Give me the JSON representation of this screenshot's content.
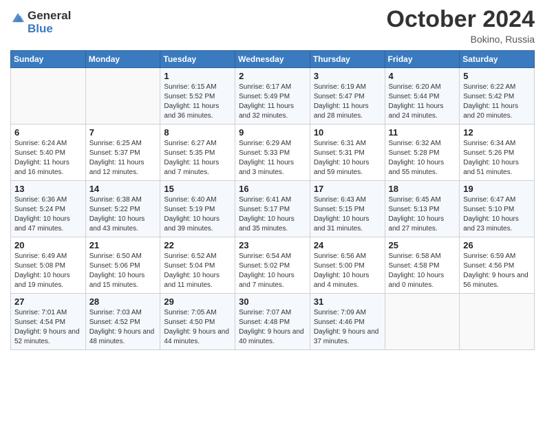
{
  "logo": {
    "general": "General",
    "blue": "Blue"
  },
  "title": "October 2024",
  "location": "Bokino, Russia",
  "days_of_week": [
    "Sunday",
    "Monday",
    "Tuesday",
    "Wednesday",
    "Thursday",
    "Friday",
    "Saturday"
  ],
  "weeks": [
    [
      {
        "day": "",
        "sunrise": "",
        "sunset": "",
        "daylight": ""
      },
      {
        "day": "",
        "sunrise": "",
        "sunset": "",
        "daylight": ""
      },
      {
        "day": "1",
        "sunrise": "Sunrise: 6:15 AM",
        "sunset": "Sunset: 5:52 PM",
        "daylight": "Daylight: 11 hours and 36 minutes."
      },
      {
        "day": "2",
        "sunrise": "Sunrise: 6:17 AM",
        "sunset": "Sunset: 5:49 PM",
        "daylight": "Daylight: 11 hours and 32 minutes."
      },
      {
        "day": "3",
        "sunrise": "Sunrise: 6:19 AM",
        "sunset": "Sunset: 5:47 PM",
        "daylight": "Daylight: 11 hours and 28 minutes."
      },
      {
        "day": "4",
        "sunrise": "Sunrise: 6:20 AM",
        "sunset": "Sunset: 5:44 PM",
        "daylight": "Daylight: 11 hours and 24 minutes."
      },
      {
        "day": "5",
        "sunrise": "Sunrise: 6:22 AM",
        "sunset": "Sunset: 5:42 PM",
        "daylight": "Daylight: 11 hours and 20 minutes."
      }
    ],
    [
      {
        "day": "6",
        "sunrise": "Sunrise: 6:24 AM",
        "sunset": "Sunset: 5:40 PM",
        "daylight": "Daylight: 11 hours and 16 minutes."
      },
      {
        "day": "7",
        "sunrise": "Sunrise: 6:25 AM",
        "sunset": "Sunset: 5:37 PM",
        "daylight": "Daylight: 11 hours and 12 minutes."
      },
      {
        "day": "8",
        "sunrise": "Sunrise: 6:27 AM",
        "sunset": "Sunset: 5:35 PM",
        "daylight": "Daylight: 11 hours and 7 minutes."
      },
      {
        "day": "9",
        "sunrise": "Sunrise: 6:29 AM",
        "sunset": "Sunset: 5:33 PM",
        "daylight": "Daylight: 11 hours and 3 minutes."
      },
      {
        "day": "10",
        "sunrise": "Sunrise: 6:31 AM",
        "sunset": "Sunset: 5:31 PM",
        "daylight": "Daylight: 10 hours and 59 minutes."
      },
      {
        "day": "11",
        "sunrise": "Sunrise: 6:32 AM",
        "sunset": "Sunset: 5:28 PM",
        "daylight": "Daylight: 10 hours and 55 minutes."
      },
      {
        "day": "12",
        "sunrise": "Sunrise: 6:34 AM",
        "sunset": "Sunset: 5:26 PM",
        "daylight": "Daylight: 10 hours and 51 minutes."
      }
    ],
    [
      {
        "day": "13",
        "sunrise": "Sunrise: 6:36 AM",
        "sunset": "Sunset: 5:24 PM",
        "daylight": "Daylight: 10 hours and 47 minutes."
      },
      {
        "day": "14",
        "sunrise": "Sunrise: 6:38 AM",
        "sunset": "Sunset: 5:22 PM",
        "daylight": "Daylight: 10 hours and 43 minutes."
      },
      {
        "day": "15",
        "sunrise": "Sunrise: 6:40 AM",
        "sunset": "Sunset: 5:19 PM",
        "daylight": "Daylight: 10 hours and 39 minutes."
      },
      {
        "day": "16",
        "sunrise": "Sunrise: 6:41 AM",
        "sunset": "Sunset: 5:17 PM",
        "daylight": "Daylight: 10 hours and 35 minutes."
      },
      {
        "day": "17",
        "sunrise": "Sunrise: 6:43 AM",
        "sunset": "Sunset: 5:15 PM",
        "daylight": "Daylight: 10 hours and 31 minutes."
      },
      {
        "day": "18",
        "sunrise": "Sunrise: 6:45 AM",
        "sunset": "Sunset: 5:13 PM",
        "daylight": "Daylight: 10 hours and 27 minutes."
      },
      {
        "day": "19",
        "sunrise": "Sunrise: 6:47 AM",
        "sunset": "Sunset: 5:10 PM",
        "daylight": "Daylight: 10 hours and 23 minutes."
      }
    ],
    [
      {
        "day": "20",
        "sunrise": "Sunrise: 6:49 AM",
        "sunset": "Sunset: 5:08 PM",
        "daylight": "Daylight: 10 hours and 19 minutes."
      },
      {
        "day": "21",
        "sunrise": "Sunrise: 6:50 AM",
        "sunset": "Sunset: 5:06 PM",
        "daylight": "Daylight: 10 hours and 15 minutes."
      },
      {
        "day": "22",
        "sunrise": "Sunrise: 6:52 AM",
        "sunset": "Sunset: 5:04 PM",
        "daylight": "Daylight: 10 hours and 11 minutes."
      },
      {
        "day": "23",
        "sunrise": "Sunrise: 6:54 AM",
        "sunset": "Sunset: 5:02 PM",
        "daylight": "Daylight: 10 hours and 7 minutes."
      },
      {
        "day": "24",
        "sunrise": "Sunrise: 6:56 AM",
        "sunset": "Sunset: 5:00 PM",
        "daylight": "Daylight: 10 hours and 4 minutes."
      },
      {
        "day": "25",
        "sunrise": "Sunrise: 6:58 AM",
        "sunset": "Sunset: 4:58 PM",
        "daylight": "Daylight: 10 hours and 0 minutes."
      },
      {
        "day": "26",
        "sunrise": "Sunrise: 6:59 AM",
        "sunset": "Sunset: 4:56 PM",
        "daylight": "Daylight: 9 hours and 56 minutes."
      }
    ],
    [
      {
        "day": "27",
        "sunrise": "Sunrise: 7:01 AM",
        "sunset": "Sunset: 4:54 PM",
        "daylight": "Daylight: 9 hours and 52 minutes."
      },
      {
        "day": "28",
        "sunrise": "Sunrise: 7:03 AM",
        "sunset": "Sunset: 4:52 PM",
        "daylight": "Daylight: 9 hours and 48 minutes."
      },
      {
        "day": "29",
        "sunrise": "Sunrise: 7:05 AM",
        "sunset": "Sunset: 4:50 PM",
        "daylight": "Daylight: 9 hours and 44 minutes."
      },
      {
        "day": "30",
        "sunrise": "Sunrise: 7:07 AM",
        "sunset": "Sunset: 4:48 PM",
        "daylight": "Daylight: 9 hours and 40 minutes."
      },
      {
        "day": "31",
        "sunrise": "Sunrise: 7:09 AM",
        "sunset": "Sunset: 4:46 PM",
        "daylight": "Daylight: 9 hours and 37 minutes."
      },
      {
        "day": "",
        "sunrise": "",
        "sunset": "",
        "daylight": ""
      },
      {
        "day": "",
        "sunrise": "",
        "sunset": "",
        "daylight": ""
      }
    ]
  ]
}
